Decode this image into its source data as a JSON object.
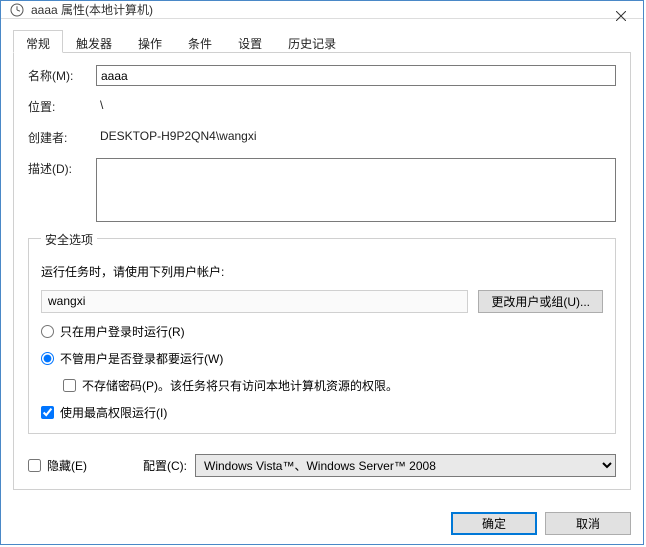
{
  "title": "aaaa 属性(本地计算机)",
  "tabs": {
    "general": "常规",
    "triggers": "触发器",
    "actions": "操作",
    "conditions": "条件",
    "settings": "设置",
    "history": "历史记录"
  },
  "labels": {
    "name": "名称(M):",
    "location": "位置:",
    "author": "创建者:",
    "description": "描述(D):",
    "security": "安全选项",
    "runPrompt": "运行任务时，请使用下列用户帐户:",
    "changeUser": "更改用户或组(U)...",
    "r_onlyLogged": "只在用户登录时运行(R)",
    "r_always": "不管用户是否登录都要运行(W)",
    "c_noStore": "不存储密码(P)。该任务将只有访问本地计算机资源的权限。",
    "c_highest": "使用最高权限运行(I)",
    "c_hidden": "隐藏(E)",
    "config": "配置(C):",
    "ok": "确定",
    "cancel": "取消"
  },
  "values": {
    "name": "aaaa",
    "location": "\\",
    "author": "DESKTOP-H9P2QN4\\wangxi",
    "description": "",
    "user": "wangxi",
    "configSelected": "Windows Vista™、Windows Server™ 2008"
  },
  "state": {
    "radioSelected": "always",
    "noStore": false,
    "highest": true,
    "hidden": false
  }
}
